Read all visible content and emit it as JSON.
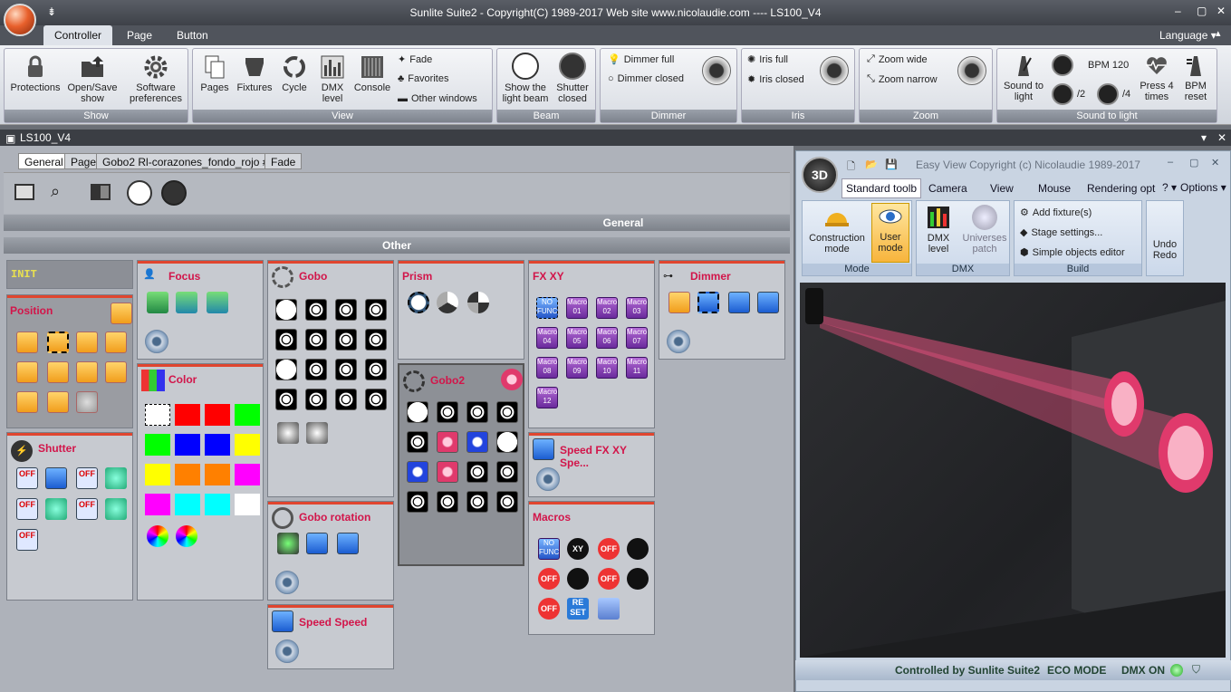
{
  "window": {
    "title": "Sunlite Suite2 - Copyright(C) 1989-2017    Web site www.nicolaudie.com ---- LS100_V4"
  },
  "ribbon_tabs": [
    "Controller",
    "Page",
    "Button"
  ],
  "language_label": "Language ▾",
  "groups": {
    "show": {
      "caption": "Show",
      "protections": "Protections",
      "open_save": "Open/Save show",
      "software_pref": "Software preferences"
    },
    "view": {
      "caption": "View",
      "pages": "Pages",
      "fixtures": "Fixtures",
      "cycle": "Cycle",
      "dmx_level": "DMX level",
      "console": "Console",
      "fade": "Fade",
      "favorites": "Favorites",
      "other_windows": "Other windows"
    },
    "beam": {
      "caption": "Beam",
      "show_light": "Show the light beam",
      "shutter_closed": "Shutter closed"
    },
    "dimmer": {
      "caption": "Dimmer",
      "full": "Dimmer full",
      "closed": "Dimmer closed"
    },
    "iris": {
      "caption": "Iris",
      "full": "Iris full",
      "closed": "Iris closed"
    },
    "zoom": {
      "caption": "Zoom",
      "wide": "Zoom wide",
      "narrow": "Zoom narrow"
    },
    "sound": {
      "caption": "Sound to light",
      "sound_to_light": "Sound to light",
      "div2": "/2",
      "div4": "/4",
      "bpm": "BPM 120",
      "press4": "Press 4 times",
      "bpm_reset": "BPM reset"
    }
  },
  "doc": {
    "title": "LS100_V4",
    "tabs": [
      "General",
      "Page",
      "Gobo2 Rl-corazones_fondo_rojo #2",
      "Fade"
    ],
    "section_general": "General",
    "section_other": "Other"
  },
  "panels": {
    "init": "INIT",
    "position": "Position",
    "shutter": "Shutter",
    "focus": "Focus",
    "color": "Color",
    "gobo": "Gobo",
    "gobo_rotation": "Gobo rotation",
    "speed_speed": "Speed Speed",
    "prism": "Prism",
    "gobo2": "Gobo2",
    "fxxy": "FX XY",
    "speed_fx": "Speed FX XY Spe...",
    "macros": "Macros",
    "dimmer": "Dimmer"
  },
  "fx_macros": [
    "NO FUNC",
    "Macro 01",
    "Macro 02",
    "Macro 03",
    "Macro 04",
    "Macro 05",
    "Macro 06",
    "Macro 07",
    "Macro 08",
    "Macro 09",
    "Macro 10",
    "Macro 11",
    "Macro 12"
  ],
  "colors": [
    "#ffffff",
    "#ff0000",
    "#ff0000",
    "#00ff00",
    "#00ff00",
    "#0000ff",
    "#0000ff",
    "#ffff00",
    "#ffff00",
    "#ff8000",
    "#ff8000",
    "#ff00ff",
    "#ff00ff",
    "#00ffff",
    "#00ffff",
    "#ffffff"
  ],
  "easyview": {
    "title": "Easy View   Copyright (c) Nicolaudie 1989-2017",
    "badge": "3D",
    "tabs": [
      "Standard toolb",
      "Camera",
      "View",
      "Mouse",
      "Rendering opt"
    ],
    "options": "Options ▾",
    "help": "? ▾",
    "construction": "Construction mode",
    "user": "User mode",
    "mode_cap": "Mode",
    "dmx_level": "DMX level",
    "universes": "Universes patch",
    "dmx_cap": "DMX",
    "add_fixture": "Add fixture(s)",
    "stage_settings": "Stage settings...",
    "simple_objects": "Simple objects editor",
    "build_cap": "Build",
    "undo_redo": "Undo Redo"
  },
  "status": {
    "controlled": "Controlled by Sunlite Suite2",
    "eco": "ECO MODE",
    "dmx": "DMX ON"
  }
}
